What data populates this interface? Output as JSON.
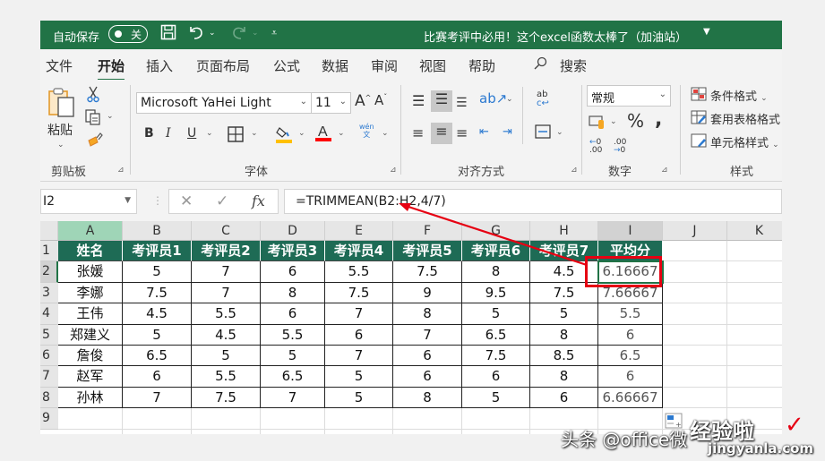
{
  "titlebar": {
    "autosave_label": "自动保存",
    "autosave_state": "关",
    "doc_title": "比赛考评中必用！这个excel函数太棒了（加油站）",
    "icons": [
      "save-icon",
      "undo-icon",
      "redo-icon",
      "customize-qat-icon"
    ]
  },
  "tabs": [
    {
      "label": "文件"
    },
    {
      "label": "开始",
      "active": true
    },
    {
      "label": "插入"
    },
    {
      "label": "页面布局"
    },
    {
      "label": "公式"
    },
    {
      "label": "数据"
    },
    {
      "label": "审阅"
    },
    {
      "label": "视图"
    },
    {
      "label": "帮助"
    }
  ],
  "search_label": "搜索",
  "ribbon": {
    "clipboard": {
      "label": "剪贴板",
      "paste": "粘贴"
    },
    "font": {
      "label": "字体",
      "font_name": "Microsoft YaHei Light",
      "font_size": "11",
      "bold": "B",
      "italic": "I",
      "underline": "U",
      "phonetic_top": "wén",
      "phonetic_bottom": "文",
      "fill_color": "#ffc000",
      "font_color": "#ff0000"
    },
    "alignment": {
      "label": "对齐方式"
    },
    "number": {
      "label": "数字",
      "format": "常规",
      "percent": "%",
      "comma": "❜",
      "inc_decimal": "←0\n.00",
      "dec_decimal": ".00\n→0"
    },
    "styles": {
      "label": "样式",
      "conditional": "条件格式",
      "table": "套用表格格式",
      "cell_styles": "单元格样式"
    }
  },
  "formula_bar": {
    "name_box": "I2",
    "formula": "=TRIMMEAN(B2:H2,4/7)",
    "fx": "fx"
  },
  "sheet": {
    "columns": [
      "A",
      "B",
      "C",
      "D",
      "E",
      "F",
      "G",
      "H",
      "I",
      "J",
      "K"
    ],
    "rows": [
      "1",
      "2",
      "3",
      "4",
      "5",
      "6",
      "7",
      "8",
      "9"
    ],
    "header": [
      "姓名",
      "考评员1",
      "考评员2",
      "考评员3",
      "考评员4",
      "考评员5",
      "考评员6",
      "考评员7",
      "平均分"
    ],
    "data": [
      [
        "张媛",
        "5",
        "7",
        "6",
        "5.5",
        "7.5",
        "8",
        "4.5",
        "6.16667"
      ],
      [
        "李娜",
        "7.5",
        "7",
        "8",
        "7.5",
        "9",
        "9.5",
        "7.5",
        "7.66667"
      ],
      [
        "王伟",
        "4.5",
        "5.5",
        "6",
        "7",
        "8",
        "5",
        "5",
        "5.5"
      ],
      [
        "郑建义",
        "5",
        "4.5",
        "5.5",
        "6",
        "7",
        "6.5",
        "8",
        "6"
      ],
      [
        "詹俊",
        "6.5",
        "5",
        "5",
        "7",
        "6",
        "7.5",
        "8.5",
        "6.5"
      ],
      [
        "赵军",
        "6",
        "5.5",
        "6.5",
        "5",
        "6",
        "6",
        "8",
        "6"
      ],
      [
        "孙林",
        "7",
        "7.5",
        "7",
        "5",
        "8",
        "5",
        "6",
        "6.66667"
      ]
    ],
    "selected_cell": "I2",
    "header_color": "#1e6b55",
    "highlight_color": "#e60012"
  },
  "watermark": {
    "line1": "头条 @office微",
    "line2": "经验啦",
    "line3": "jingyanla.com"
  }
}
